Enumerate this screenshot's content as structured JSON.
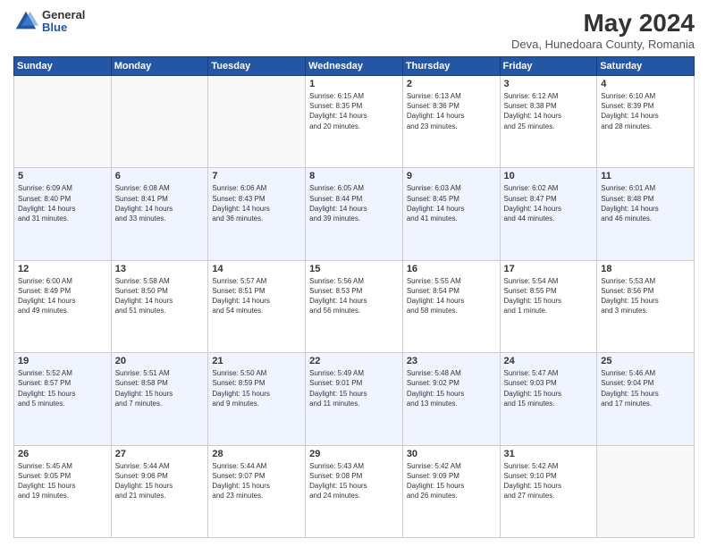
{
  "header": {
    "logo": {
      "general": "General",
      "blue": "Blue"
    },
    "title": "May 2024",
    "subtitle": "Deva, Hunedoara County, Romania"
  },
  "weekdays": [
    "Sunday",
    "Monday",
    "Tuesday",
    "Wednesday",
    "Thursday",
    "Friday",
    "Saturday"
  ],
  "weeks": [
    [
      {
        "day": "",
        "info": ""
      },
      {
        "day": "",
        "info": ""
      },
      {
        "day": "",
        "info": ""
      },
      {
        "day": "1",
        "info": "Sunrise: 6:15 AM\nSunset: 8:35 PM\nDaylight: 14 hours\nand 20 minutes."
      },
      {
        "day": "2",
        "info": "Sunrise: 6:13 AM\nSunset: 8:36 PM\nDaylight: 14 hours\nand 23 minutes."
      },
      {
        "day": "3",
        "info": "Sunrise: 6:12 AM\nSunset: 8:38 PM\nDaylight: 14 hours\nand 25 minutes."
      },
      {
        "day": "4",
        "info": "Sunrise: 6:10 AM\nSunset: 8:39 PM\nDaylight: 14 hours\nand 28 minutes."
      }
    ],
    [
      {
        "day": "5",
        "info": "Sunrise: 6:09 AM\nSunset: 8:40 PM\nDaylight: 14 hours\nand 31 minutes."
      },
      {
        "day": "6",
        "info": "Sunrise: 6:08 AM\nSunset: 8:41 PM\nDaylight: 14 hours\nand 33 minutes."
      },
      {
        "day": "7",
        "info": "Sunrise: 6:06 AM\nSunset: 8:43 PM\nDaylight: 14 hours\nand 36 minutes."
      },
      {
        "day": "8",
        "info": "Sunrise: 6:05 AM\nSunset: 8:44 PM\nDaylight: 14 hours\nand 39 minutes."
      },
      {
        "day": "9",
        "info": "Sunrise: 6:03 AM\nSunset: 8:45 PM\nDaylight: 14 hours\nand 41 minutes."
      },
      {
        "day": "10",
        "info": "Sunrise: 6:02 AM\nSunset: 8:47 PM\nDaylight: 14 hours\nand 44 minutes."
      },
      {
        "day": "11",
        "info": "Sunrise: 6:01 AM\nSunset: 8:48 PM\nDaylight: 14 hours\nand 46 minutes."
      }
    ],
    [
      {
        "day": "12",
        "info": "Sunrise: 6:00 AM\nSunset: 8:49 PM\nDaylight: 14 hours\nand 49 minutes."
      },
      {
        "day": "13",
        "info": "Sunrise: 5:58 AM\nSunset: 8:50 PM\nDaylight: 14 hours\nand 51 minutes."
      },
      {
        "day": "14",
        "info": "Sunrise: 5:57 AM\nSunset: 8:51 PM\nDaylight: 14 hours\nand 54 minutes."
      },
      {
        "day": "15",
        "info": "Sunrise: 5:56 AM\nSunset: 8:53 PM\nDaylight: 14 hours\nand 56 minutes."
      },
      {
        "day": "16",
        "info": "Sunrise: 5:55 AM\nSunset: 8:54 PM\nDaylight: 14 hours\nand 58 minutes."
      },
      {
        "day": "17",
        "info": "Sunrise: 5:54 AM\nSunset: 8:55 PM\nDaylight: 15 hours\nand 1 minute."
      },
      {
        "day": "18",
        "info": "Sunrise: 5:53 AM\nSunset: 8:56 PM\nDaylight: 15 hours\nand 3 minutes."
      }
    ],
    [
      {
        "day": "19",
        "info": "Sunrise: 5:52 AM\nSunset: 8:57 PM\nDaylight: 15 hours\nand 5 minutes."
      },
      {
        "day": "20",
        "info": "Sunrise: 5:51 AM\nSunset: 8:58 PM\nDaylight: 15 hours\nand 7 minutes."
      },
      {
        "day": "21",
        "info": "Sunrise: 5:50 AM\nSunset: 8:59 PM\nDaylight: 15 hours\nand 9 minutes."
      },
      {
        "day": "22",
        "info": "Sunrise: 5:49 AM\nSunset: 9:01 PM\nDaylight: 15 hours\nand 11 minutes."
      },
      {
        "day": "23",
        "info": "Sunrise: 5:48 AM\nSunset: 9:02 PM\nDaylight: 15 hours\nand 13 minutes."
      },
      {
        "day": "24",
        "info": "Sunrise: 5:47 AM\nSunset: 9:03 PM\nDaylight: 15 hours\nand 15 minutes."
      },
      {
        "day": "25",
        "info": "Sunrise: 5:46 AM\nSunset: 9:04 PM\nDaylight: 15 hours\nand 17 minutes."
      }
    ],
    [
      {
        "day": "26",
        "info": "Sunrise: 5:45 AM\nSunset: 9:05 PM\nDaylight: 15 hours\nand 19 minutes."
      },
      {
        "day": "27",
        "info": "Sunrise: 5:44 AM\nSunset: 9:06 PM\nDaylight: 15 hours\nand 21 minutes."
      },
      {
        "day": "28",
        "info": "Sunrise: 5:44 AM\nSunset: 9:07 PM\nDaylight: 15 hours\nand 23 minutes."
      },
      {
        "day": "29",
        "info": "Sunrise: 5:43 AM\nSunset: 9:08 PM\nDaylight: 15 hours\nand 24 minutes."
      },
      {
        "day": "30",
        "info": "Sunrise: 5:42 AM\nSunset: 9:09 PM\nDaylight: 15 hours\nand 26 minutes."
      },
      {
        "day": "31",
        "info": "Sunrise: 5:42 AM\nSunset: 9:10 PM\nDaylight: 15 hours\nand 27 minutes."
      },
      {
        "day": "",
        "info": ""
      }
    ]
  ]
}
